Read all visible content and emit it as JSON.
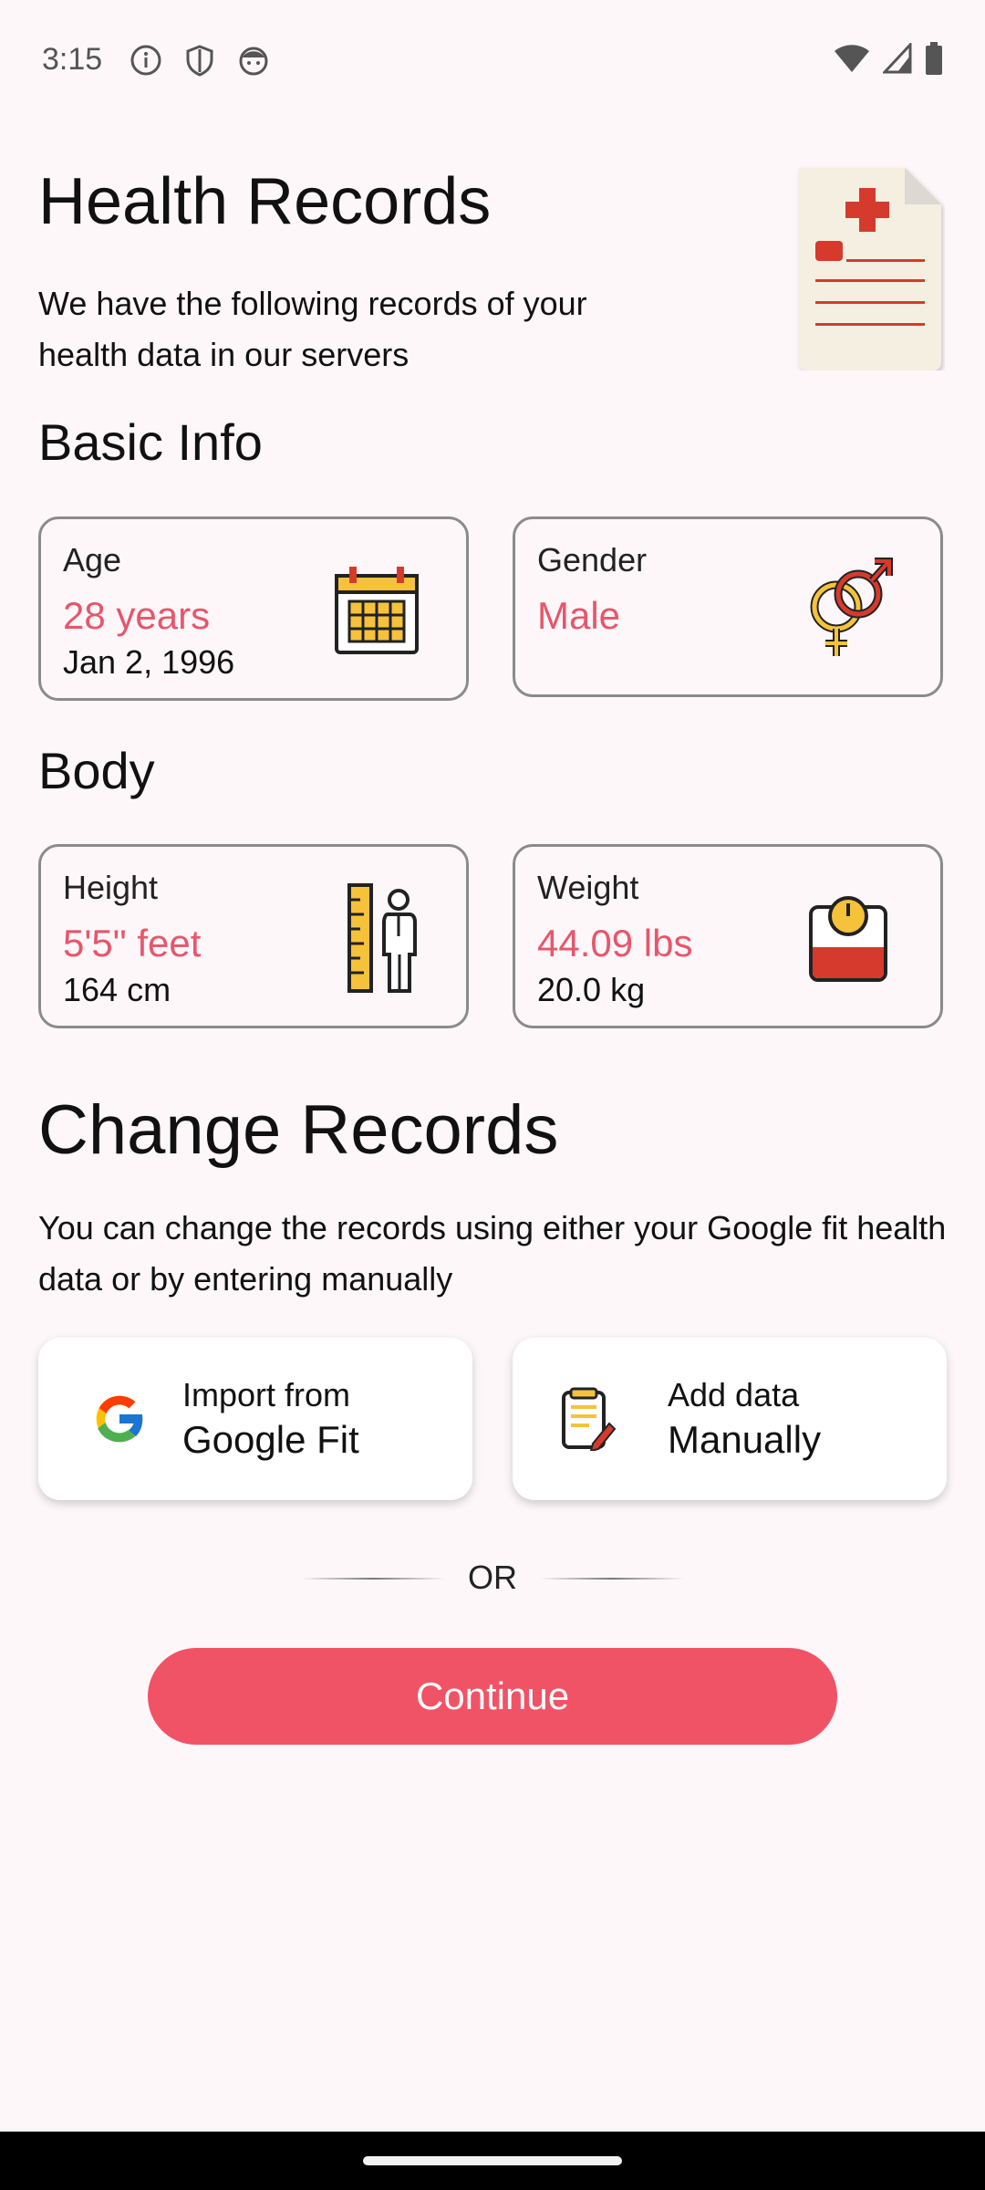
{
  "status_bar": {
    "time": "3:15",
    "left_icons": [
      "info-icon",
      "shield-icon",
      "face-icon"
    ],
    "right_icons": [
      "wifi-icon",
      "signal-icon",
      "battery-icon"
    ]
  },
  "header": {
    "title": "Health Records",
    "subtitle": "We have the following records of your health data in our servers"
  },
  "basic_info": {
    "heading": "Basic Info",
    "age": {
      "label": "Age",
      "value": "28 years",
      "detail": "Jan 2, 1996",
      "icon": "calendar-icon"
    },
    "gender": {
      "label": "Gender",
      "value": "Male",
      "icon": "gender-icon"
    }
  },
  "body": {
    "heading": "Body",
    "height": {
      "label": "Height",
      "value": "5'5\" feet",
      "detail": "164 cm",
      "icon": "ruler-person-icon"
    },
    "weight": {
      "label": "Weight",
      "value": "44.09 lbs",
      "detail": "20.0 kg",
      "icon": "scale-icon"
    }
  },
  "change_records": {
    "heading": "Change Records",
    "description": "You can change the records using either your Google fit health data or by entering manually",
    "import": {
      "line1": "Import from",
      "line2": "Google Fit",
      "icon": "google-icon"
    },
    "manual": {
      "line1": "Add data",
      "line2": "Manually",
      "icon": "notepad-pen-icon"
    },
    "or_label": "OR",
    "continue_label": "Continue"
  },
  "colors": {
    "accent": "#f05365",
    "value_text": "#e7566b",
    "background": "#fdf7fa"
  }
}
